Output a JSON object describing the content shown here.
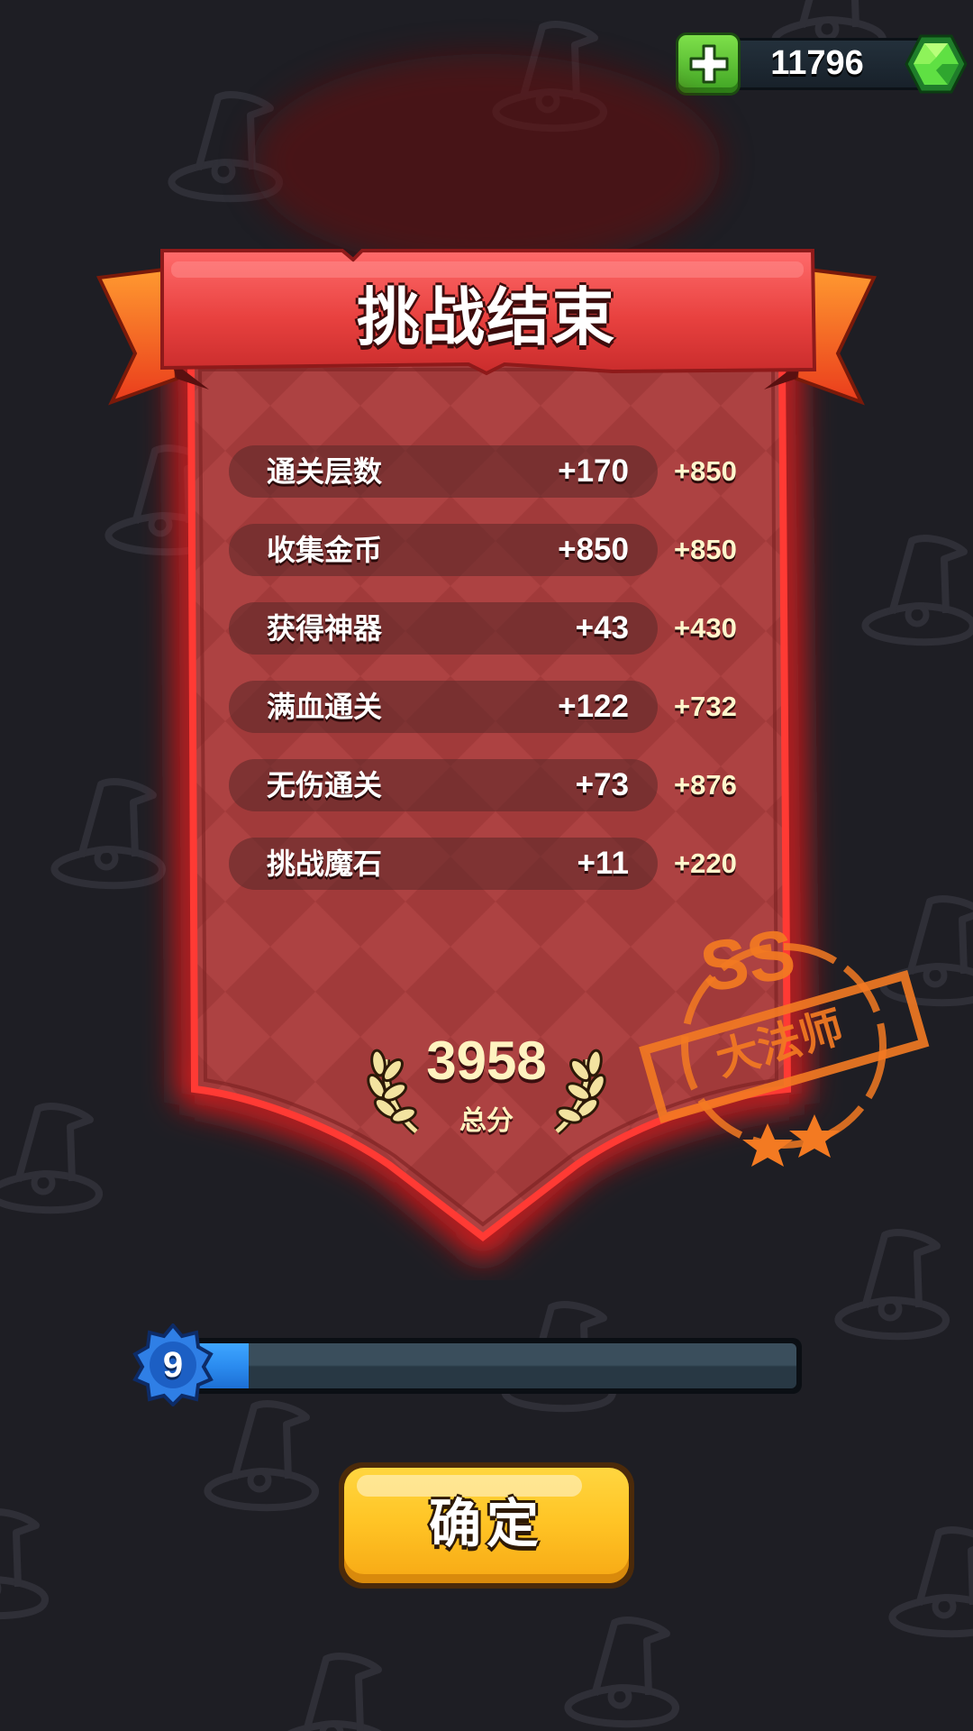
{
  "currency": {
    "gems": "11796",
    "add_icon": "plus-icon",
    "gem_icon": "green-gem-icon",
    "colors": {
      "add_button": "#5ac232",
      "gem": "#4fdc3c"
    }
  },
  "result": {
    "title": "挑战结束",
    "stats": [
      {
        "label": "通关层数",
        "count": "+170",
        "points": "+850"
      },
      {
        "label": "收集金币",
        "count": "+850",
        "points": "+850"
      },
      {
        "label": "获得神器",
        "count": "+43",
        "points": "+430"
      },
      {
        "label": "满血通关",
        "count": "+122",
        "points": "+732"
      },
      {
        "label": "无伤通关",
        "count": "+73",
        "points": "+876"
      },
      {
        "label": "挑战魔石",
        "count": "+11",
        "points": "+220"
      }
    ],
    "total_score": "3958",
    "total_label": "总分",
    "colors": {
      "banner": "#e84848",
      "panel": "#a83c3c",
      "glow": "#ff2a2a"
    }
  },
  "rank": {
    "grade": "SS",
    "title": "大法师",
    "stars": 2,
    "color": "#f37a22"
  },
  "level": {
    "number": "9",
    "progress": 0.09,
    "color": "#2b8cf0"
  },
  "confirm": {
    "label": "确定",
    "color": "#ffc526"
  }
}
